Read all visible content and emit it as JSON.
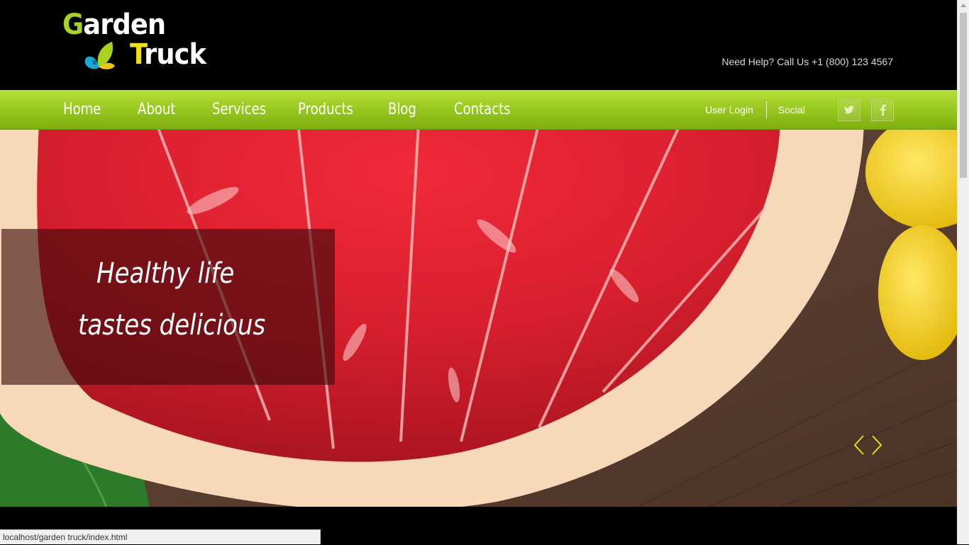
{
  "logo": {
    "word1_cap": "G",
    "word1_rest": "arden",
    "word2_cap": "T",
    "word2_rest": "ruck"
  },
  "header": {
    "help_text": "Need Help? Call Us +1 (800) 123 4567"
  },
  "nav": {
    "items": [
      {
        "label": "Home"
      },
      {
        "label": "About"
      },
      {
        "label": "Services"
      },
      {
        "label": "Products"
      },
      {
        "label": "Blog"
      },
      {
        "label": "Contacts"
      }
    ],
    "user_login": "User Login",
    "social": "Social",
    "icons": [
      "twitter-icon",
      "facebook-icon"
    ]
  },
  "slider": {
    "line1": "Healthy life",
    "line2": "tastes delicious"
  },
  "status_bar": {
    "url": "localhost/garden truck/index.html"
  },
  "colors": {
    "accent_green": "#95c51d",
    "logo_yellow": "#f0e20e",
    "arrow_yellow": "#d8e21a"
  }
}
